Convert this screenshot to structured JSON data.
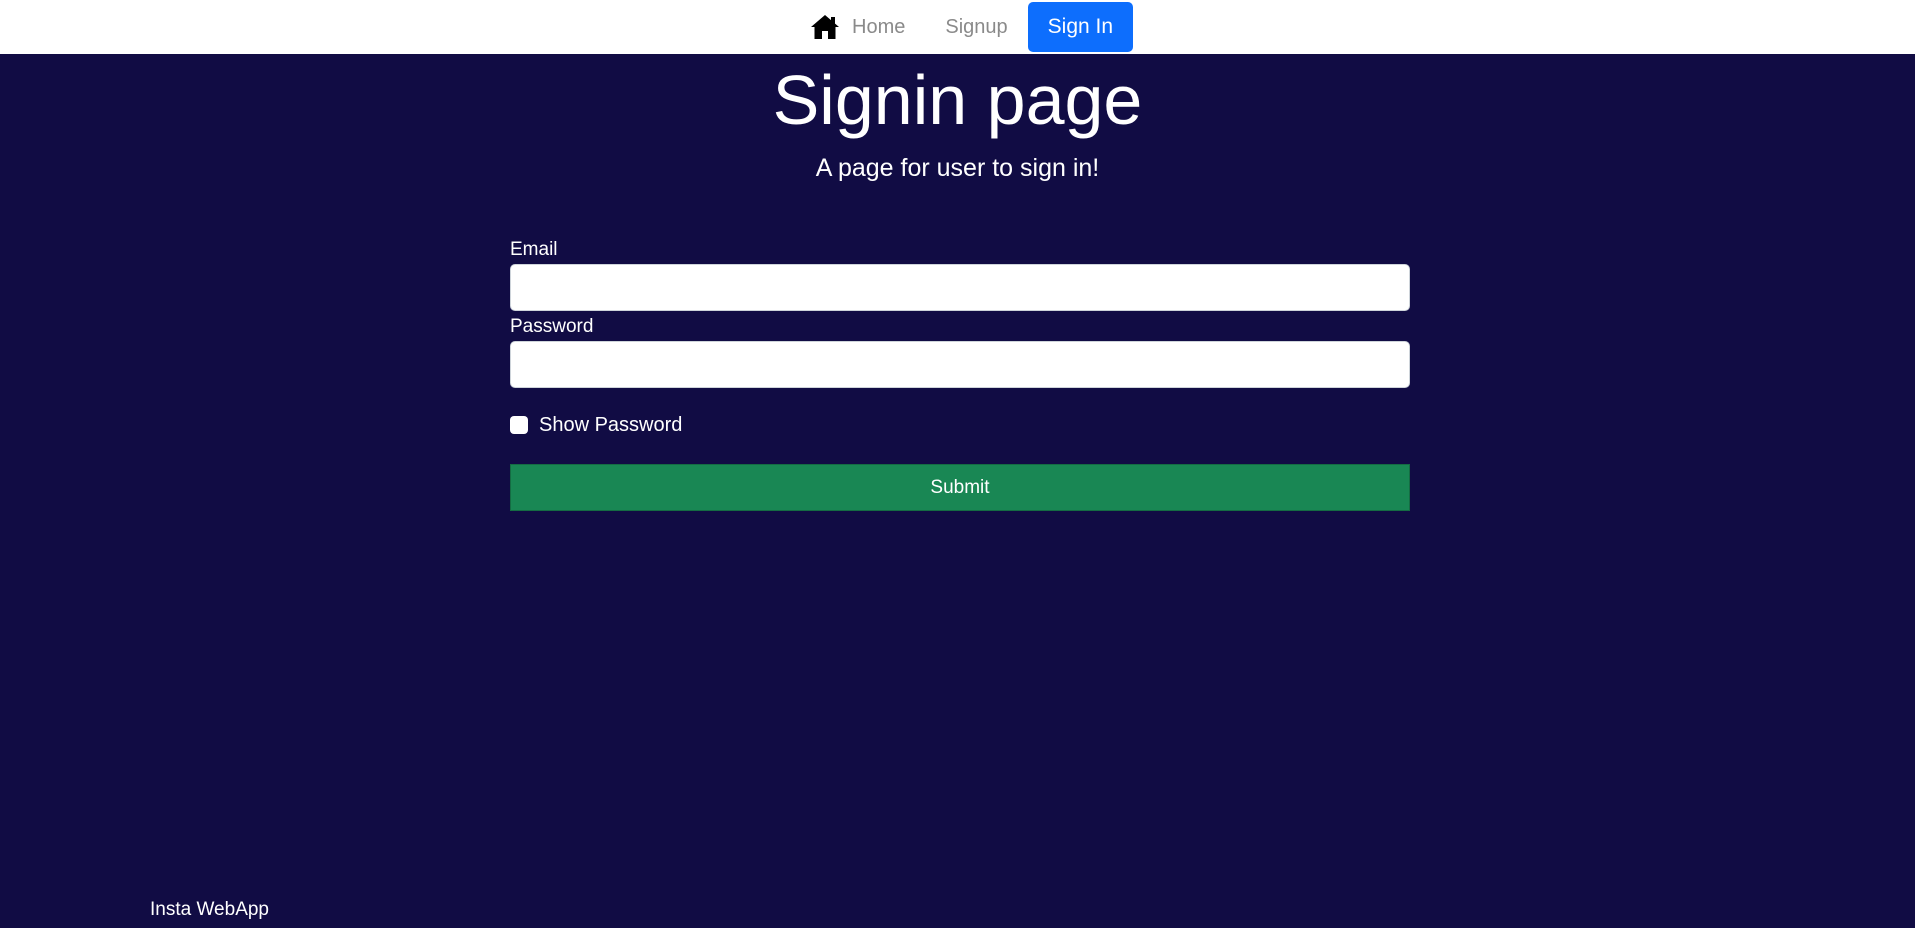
{
  "navbar": {
    "home_icon": "home-icon",
    "home_label": "Home",
    "signup_label": "Signup",
    "signin_label": "Sign In"
  },
  "page": {
    "title": "Signin page",
    "subtitle": "A page for user to sign in!"
  },
  "form": {
    "email_label": "Email",
    "email_value": "",
    "password_label": "Password",
    "password_value": "",
    "show_password_label": "Show Password",
    "show_password_checked": false,
    "submit_label": "Submit"
  },
  "footer": {
    "brand": "Insta WebApp"
  },
  "colors": {
    "background": "#110c44",
    "navbar": "#ffffff",
    "signin_accent": "#0d6efd",
    "submit": "#198754"
  }
}
